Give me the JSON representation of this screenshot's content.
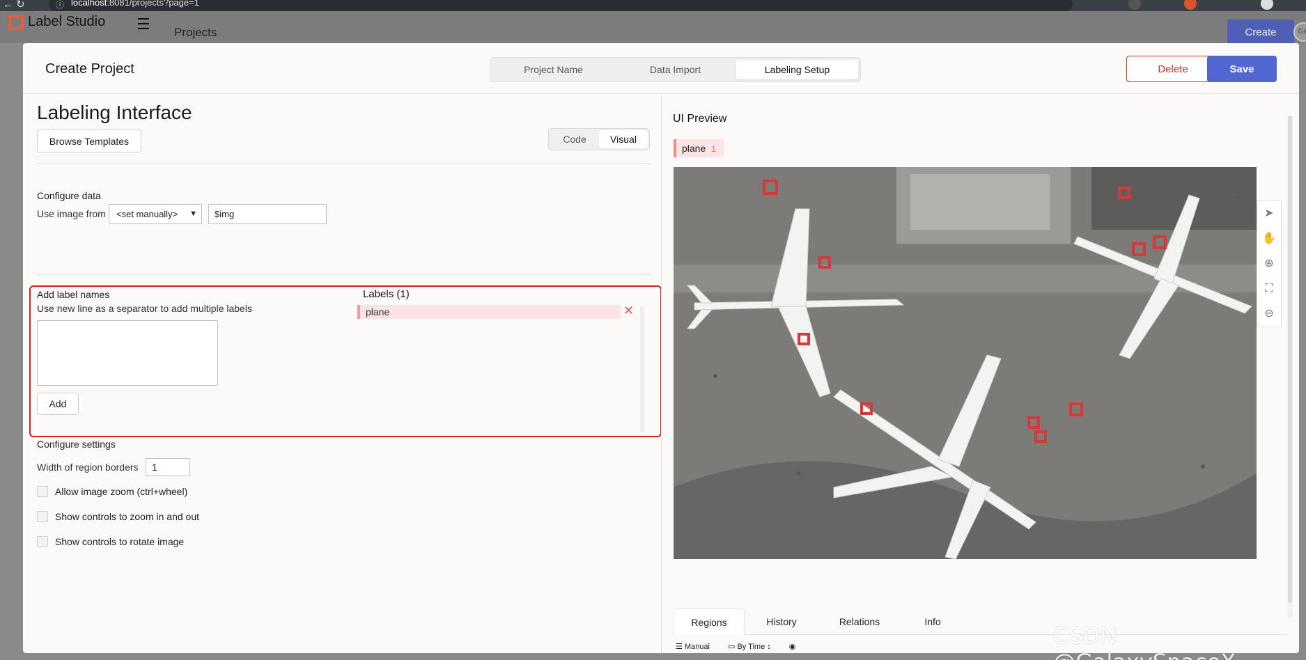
{
  "browser": {
    "url_host": "localhost",
    "url_rest": ":8081/projects?page=1"
  },
  "app": {
    "logo_text": "Label Studio",
    "header_title": "Projects",
    "create_label": "Create",
    "avatar_initials": "GA"
  },
  "modal": {
    "title": "Create Project",
    "tabs": [
      {
        "label": "Project Name",
        "active": false
      },
      {
        "label": "Data Import",
        "active": false
      },
      {
        "label": "Labeling Setup",
        "active": true
      }
    ],
    "delete_label": "Delete",
    "save_label": "Save"
  },
  "labeling": {
    "title": "Labeling Interface",
    "browse_templates": "Browse Templates",
    "mode_code": "Code",
    "mode_visual": "Visual",
    "active_mode": "Visual",
    "configure_data_title": "Configure data",
    "use_image_from": "Use image from",
    "source_select_value": "<set manually>",
    "source_value": "$img",
    "add_label_title": "Add label names",
    "add_label_hint": "Use new line as a separator to add multiple labels",
    "add_button": "Add",
    "labels_title": "Labels (1)",
    "labels": [
      {
        "name": "plane",
        "color": "#f19a9a"
      }
    ],
    "configure_settings_title": "Configure settings",
    "width_label": "Width of region borders",
    "width_value": "1",
    "options": [
      {
        "label": "Allow image zoom (ctrl+wheel)",
        "checked": false
      },
      {
        "label": "Show controls to zoom in and out",
        "checked": false
      },
      {
        "label": "Show controls to rotate image",
        "checked": false
      }
    ]
  },
  "preview": {
    "title": "UI Preview",
    "tag_label": "plane",
    "tag_count": "1",
    "tools": [
      "pointer-icon",
      "hand-icon",
      "zoom-in-icon",
      "fit-icon",
      "zoom-out-icon"
    ],
    "bottom_tabs": [
      {
        "label": "Regions",
        "active": true
      },
      {
        "label": "History",
        "active": false
      },
      {
        "label": "Relations",
        "active": false
      },
      {
        "label": "Info",
        "active": false
      }
    ],
    "sort_manual": "Manual",
    "sort_by_time": "By Time"
  },
  "watermark": "CSDN @GalaxySpaceX",
  "colors": {
    "accent": "#5367d3",
    "danger": "#d32f2f",
    "label_plane": "#f19a9a",
    "logo": "#e85c3a"
  }
}
